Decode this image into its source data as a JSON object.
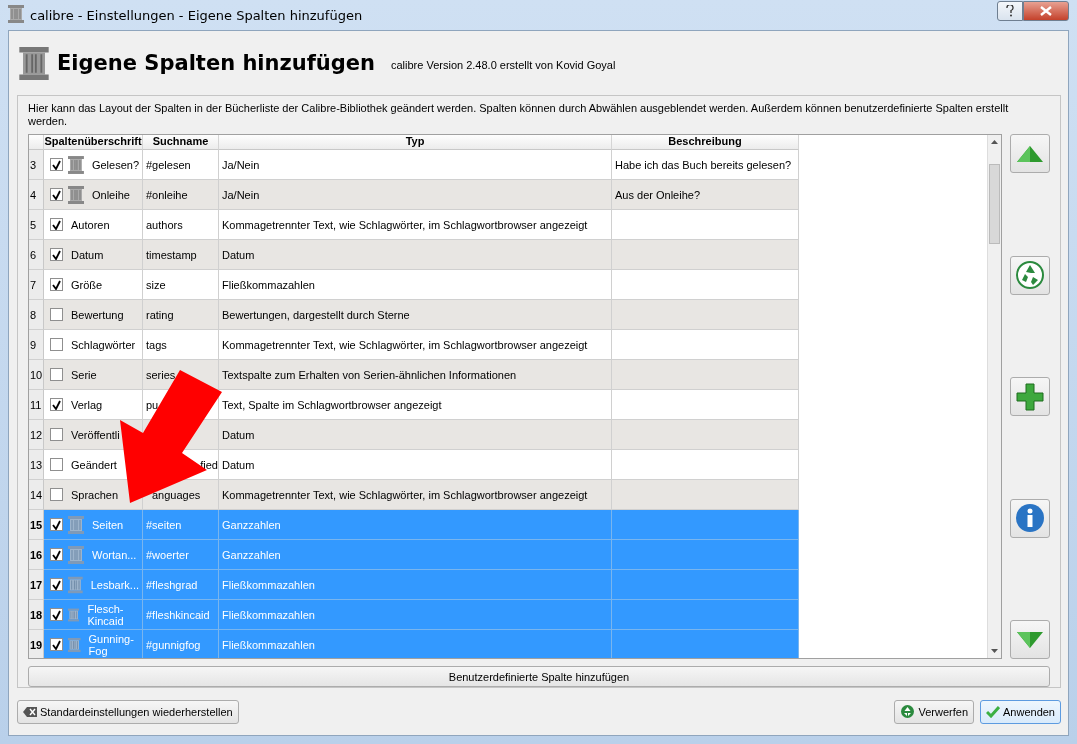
{
  "window": {
    "title": "calibre - Einstellungen - Eigene Spalten hinzufügen"
  },
  "header": {
    "title": "Eigene Spalten hinzufügen",
    "version": "calibre Version 2.48.0 erstellt von Kovid Goyal"
  },
  "description": "Hier kann das Layout der Spalten in der Bücherliste der Calibre-Bibliothek geändert werden. Spalten können durch Abwählen ausgeblendet werden. Außerdem können benutzerdefinierte Spalten erstellt werden.",
  "table": {
    "columns": [
      "Spaltenüberschrift",
      "Suchname",
      "Typ",
      "Beschreibung"
    ],
    "rows": [
      {
        "number": "3",
        "checked": true,
        "kind": "custom",
        "label": "Gelesen?",
        "search_name": "#gelesen",
        "type": "Ja/Nein",
        "description": "Habe ich das Buch bereits gelesen?",
        "selected": false
      },
      {
        "number": "4",
        "checked": true,
        "kind": "custom",
        "label": "Onleihe",
        "search_name": "#onleihe",
        "type": "Ja/Nein",
        "description": "Aus der Onleihe?",
        "selected": false
      },
      {
        "number": "5",
        "checked": true,
        "kind": "builtin",
        "label": "Autoren",
        "search_name": "authors",
        "type": "Kommagetrennter Text, wie Schlagwörter, im Schlagwortbrowser angezeigt",
        "selected": false
      },
      {
        "number": "6",
        "checked": true,
        "kind": "builtin",
        "label": "Datum",
        "search_name": "timestamp",
        "type": "Datum",
        "selected": false
      },
      {
        "number": "7",
        "checked": true,
        "kind": "builtin",
        "label": "Größe",
        "search_name": "size",
        "type": "Fließkommazahlen",
        "selected": false
      },
      {
        "number": "8",
        "checked": false,
        "kind": "builtin",
        "label": "Bewertung",
        "search_name": "rating",
        "type": "Bewertungen, dargestellt durch Sterne",
        "selected": false
      },
      {
        "number": "9",
        "checked": false,
        "kind": "builtin",
        "label": "Schlagwörter",
        "search_name": "tags",
        "type": "Kommagetrennter Text, wie Schlagwörter, im Schlagwortbrowser angezeigt",
        "selected": false
      },
      {
        "number": "10",
        "checked": false,
        "kind": "builtin",
        "label": "Serie",
        "search_name": "series",
        "type": "Textspalte zum Erhalten von Serien-ähnlichen Informationen",
        "selected": false
      },
      {
        "number": "11",
        "checked": true,
        "kind": "builtin",
        "label": "Verlag",
        "search_name": "pu",
        "type": "Text, Spalte im Schlagwortbrowser angezeigt",
        "selected": false
      },
      {
        "number": "12",
        "checked": false,
        "kind": "builtin",
        "label": "Veröffentli",
        "type": "Datum",
        "selected": false
      },
      {
        "number": "13",
        "checked": false,
        "kind": "builtin",
        "label": "Geändert",
        "search_name_tail": "fied",
        "type": "Datum",
        "selected": false
      },
      {
        "number": "14",
        "checked": false,
        "kind": "builtin",
        "label": "Sprachen",
        "search_name": "anguages",
        "type": "Kommagetrennter Text, wie Schlagwörter, im Schlagwortbrowser angezeigt",
        "selected": false
      },
      {
        "number": "15",
        "checked": true,
        "kind": "custom",
        "label": "Seiten",
        "search_name": "#seiten",
        "type": "Ganzzahlen",
        "selected": true
      },
      {
        "number": "16",
        "checked": true,
        "kind": "custom",
        "label": "Wortan...",
        "search_name": "#woerter",
        "type": "Ganzzahlen",
        "selected": true
      },
      {
        "number": "17",
        "checked": true,
        "kind": "custom",
        "label": "Lesbark...",
        "search_name": "#fleshgrad",
        "type": "Fließkommazahlen",
        "selected": true
      },
      {
        "number": "18",
        "checked": true,
        "kind": "custom",
        "label": "Flesch-Kincaid",
        "search_name": "#fleshkincaid",
        "type": "Fließkommazahlen",
        "selected": true
      },
      {
        "number": "19",
        "checked": true,
        "kind": "custom",
        "label": "Gunning-Fog",
        "search_name": "#gunnigfog",
        "type": "Fließkommazahlen",
        "selected": true
      }
    ]
  },
  "add_button": "Benutzerdefinierte Spalte hinzufügen",
  "side_buttons": [
    {
      "kind": "up"
    },
    {
      "kind": "recycle"
    },
    {
      "kind": "plus"
    },
    {
      "kind": "info"
    },
    {
      "kind": "down"
    }
  ],
  "footer": {
    "restore_button": "Standardeinstellungen wiederherstellen",
    "buttons": [
      {
        "kind": "discard",
        "label": "Verwerfen"
      },
      {
        "kind": "apply",
        "label": "Anwenden"
      }
    ]
  }
}
